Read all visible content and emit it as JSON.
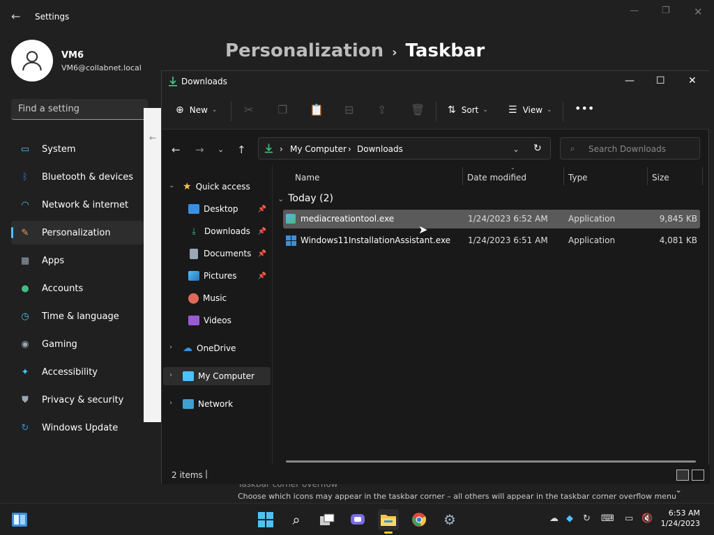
{
  "settings": {
    "title": "Settings",
    "user": {
      "name": "VM6",
      "email": "VM6@collabnet.local"
    },
    "search_placeholder": "Find a setting",
    "breadcrumb": {
      "parent": "Personalization",
      "current": "Taskbar"
    },
    "nav": [
      {
        "label": "System",
        "icon": "monitor-icon",
        "color": "#4cc2ff"
      },
      {
        "label": "Bluetooth & devices",
        "icon": "bluetooth-icon",
        "color": "#3a7bd5"
      },
      {
        "label": "Network & internet",
        "icon": "wifi-icon",
        "color": "#4cc2ff"
      },
      {
        "label": "Personalization",
        "icon": "brush-icon",
        "color": "#f0a050",
        "active": true
      },
      {
        "label": "Apps",
        "icon": "apps-icon",
        "color": "#9aa7b7"
      },
      {
        "label": "Accounts",
        "icon": "person-icon",
        "color": "#3fbf7f"
      },
      {
        "label": "Time & language",
        "icon": "clock-globe-icon",
        "color": "#4cc2ff"
      },
      {
        "label": "Gaming",
        "icon": "gamepad-icon",
        "color": "#9aa7b7"
      },
      {
        "label": "Accessibility",
        "icon": "accessibility-icon",
        "color": "#4cc2ff"
      },
      {
        "label": "Privacy & security",
        "icon": "shield-icon",
        "color": "#9aa7b7"
      },
      {
        "label": "Windows Update",
        "icon": "update-icon",
        "color": "#2f8fe0"
      }
    ],
    "overflow": {
      "title": "Taskbar corner overflow",
      "desc": "Choose which icons may appear in the taskbar corner – all others will appear in the taskbar corner overflow menu"
    }
  },
  "explorer": {
    "title": "Downloads",
    "toolbar": {
      "new": "New",
      "sort": "Sort",
      "view": "View"
    },
    "address": {
      "root": "My Computer",
      "folder": "Downloads"
    },
    "search_placeholder": "Search Downloads",
    "tree": {
      "quick_access": "Quick access",
      "items": [
        "Desktop",
        "Downloads",
        "Documents",
        "Pictures",
        "Music",
        "Videos"
      ],
      "onedrive": "OneDrive",
      "my_computer": "My Computer",
      "network": "Network"
    },
    "columns": {
      "name": "Name",
      "date": "Date modified",
      "type": "Type",
      "size": "Size"
    },
    "group": "Today (2)",
    "files": [
      {
        "name": "mediacreationtool.exe",
        "date": "1/24/2023 6:52 AM",
        "type": "Application",
        "size": "9,845 KB"
      },
      {
        "name": "Windows11InstallationAssistant.exe",
        "date": "1/24/2023 6:51 AM",
        "type": "Application",
        "size": "4,081 KB"
      }
    ],
    "status": "2 items"
  },
  "taskbar": {
    "time": "6:53 AM",
    "date": "1/24/2023"
  },
  "colors": {
    "accent": "#4cc2ff",
    "folder": "#f8c54a",
    "download": "#3fbf7f"
  }
}
